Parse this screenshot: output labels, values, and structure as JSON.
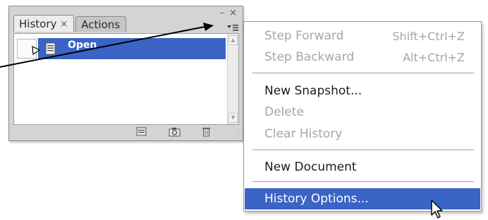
{
  "panel": {
    "tabs": [
      {
        "label": "History",
        "close_glyph": "×"
      },
      {
        "label": "Actions"
      }
    ],
    "controls": {
      "minimize_glyph": "–",
      "close_glyph": "×"
    },
    "history_items": [
      {
        "label": "Open",
        "icon": "document-icon",
        "selected": true
      }
    ],
    "footer_icons": [
      "new-document-icon",
      "camera-icon",
      "trash-icon"
    ]
  },
  "menu": {
    "step_forward": {
      "label": "Step Forward",
      "shortcut": "Shift+Ctrl+Z",
      "enabled": false
    },
    "step_backward": {
      "label": "Step Backward",
      "shortcut": "Alt+Ctrl+Z",
      "enabled": false
    },
    "new_snapshot": {
      "label": "New Snapshot...",
      "enabled": true
    },
    "delete": {
      "label": "Delete",
      "enabled": false
    },
    "clear_history": {
      "label": "Clear History",
      "enabled": false
    },
    "new_document": {
      "label": "New Document",
      "enabled": true
    },
    "history_options": {
      "label": "History Options...",
      "enabled": true,
      "highlighted": true
    }
  },
  "colors": {
    "selection": "#3a64c6",
    "panel_bg": "#d4d4d4",
    "disabled_text": "#a6a6a6"
  }
}
